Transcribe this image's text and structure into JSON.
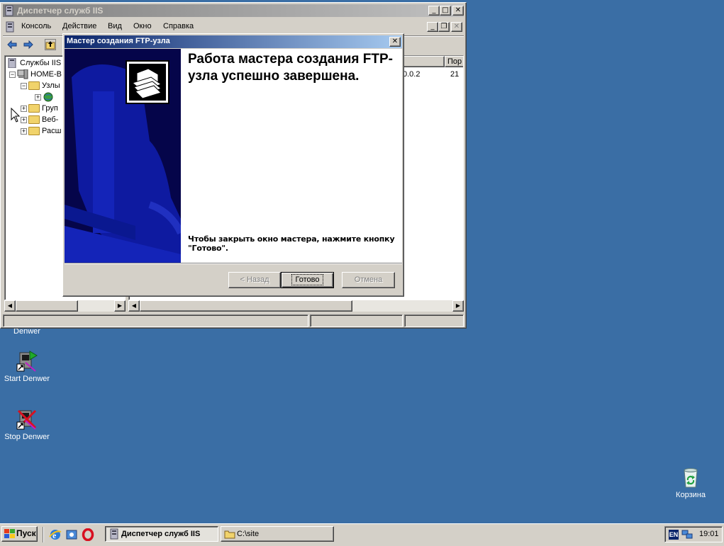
{
  "iis_window": {
    "title": "Диспетчер служб IIS",
    "menu": [
      "Консоль",
      "Действие",
      "Вид",
      "Окно",
      "Справка"
    ],
    "tree": {
      "root": "Службы IIS",
      "host": "HOME-B",
      "items": [
        "Узлы",
        "Груп",
        "Веб-",
        "Расш"
      ]
    },
    "list": {
      "col1_header": "р",
      "col2_header": "Пор",
      "row_ip": "0.0.2",
      "row_port": "21"
    }
  },
  "wizard": {
    "title": "Мастер создания FTP-узла",
    "heading": "Работа мастера создания FTP-узла успешно завершена.",
    "hint": "Чтобы закрыть окно мастера, нажмите кнопку \"Готово\".",
    "btn_back": "< Назад",
    "btn_finish": "Готово",
    "btn_cancel": "Отмена"
  },
  "desktop": {
    "icons": {
      "denwer": "Denwer",
      "start_denwer": "Start Denwer",
      "stop_denwer": "Stop Denwer",
      "recycle": "Корзина"
    }
  },
  "taskbar": {
    "start": "Пуск",
    "tasks": [
      "Диспетчер служб IIS",
      "C:\\site"
    ],
    "lang": "EN",
    "clock": "19:01"
  },
  "colors": {
    "desktop": "#3a6ea5",
    "titlebar_active": "#0a246a",
    "face": "#d4d0c8"
  }
}
